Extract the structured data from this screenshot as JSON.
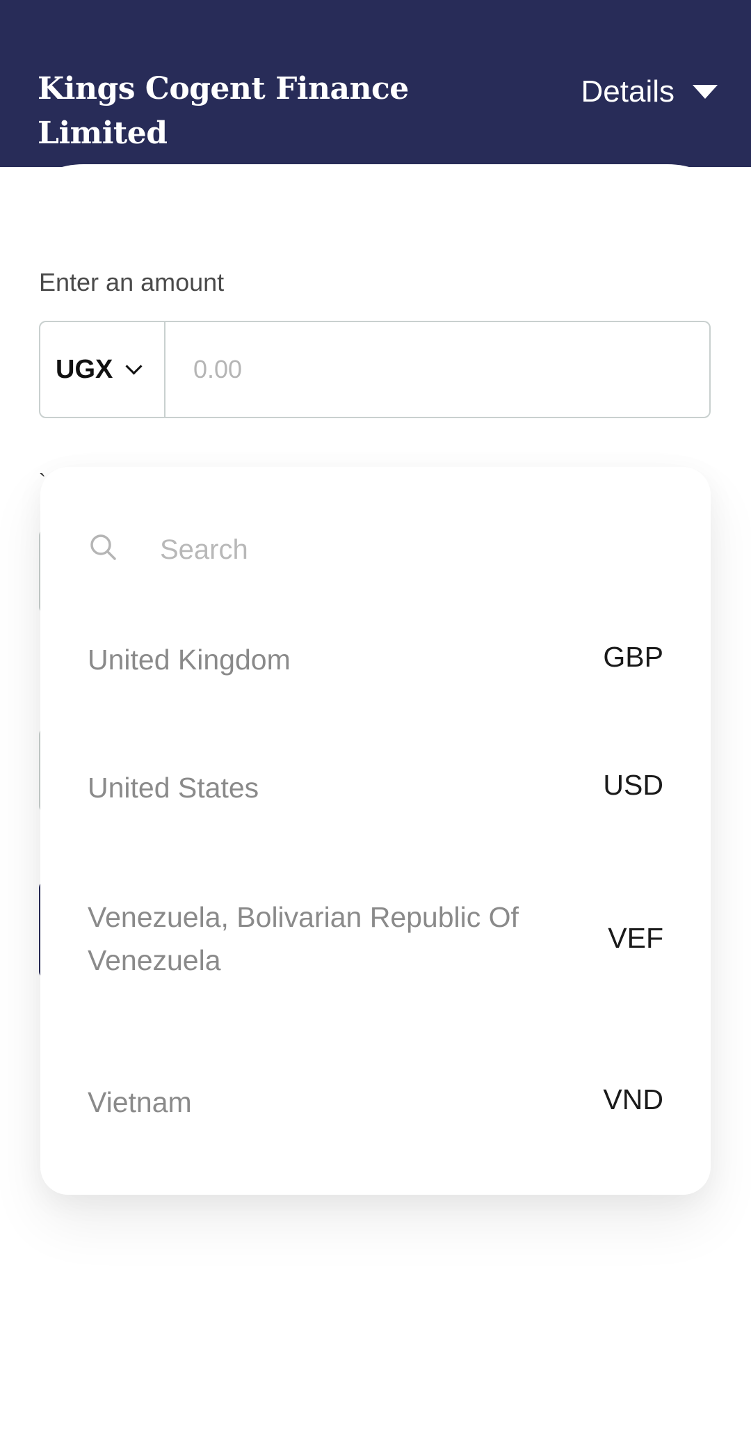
{
  "header": {
    "brand": "Kings Cogent Finance Limited",
    "details_label": "Details"
  },
  "form": {
    "amount_label": "Enter an amount",
    "currency": "UGX",
    "amount_placeholder": "0.00"
  },
  "dropdown": {
    "search_placeholder": "Search",
    "options": [
      {
        "country": "United Kingdom",
        "code": "GBP"
      },
      {
        "country": "United States",
        "code": "USD"
      },
      {
        "country": "Venezuela, Bolivarian Republic Of Venezuela",
        "code": "VEF"
      },
      {
        "country": "Vietnam",
        "code": "VND"
      }
    ]
  },
  "colors": {
    "brand_navy": "#282c58",
    "border": "#c9d0cf"
  }
}
